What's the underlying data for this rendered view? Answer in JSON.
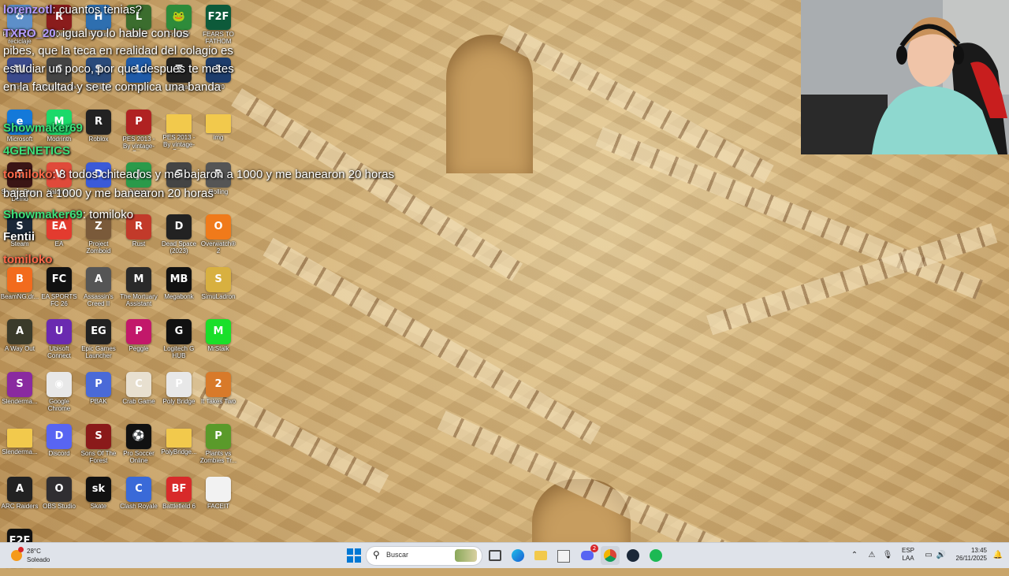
{
  "colors": {
    "taskbar_bg": "#dfe3ea",
    "chat_user_green": "#3ee07a",
    "chat_user_purple": "#b59cff",
    "chat_user_red": "#ff6a4a",
    "windows_blue": "#0078d4"
  },
  "chat": [
    {
      "user": "lorenzotl",
      "message": "cuantos tenias?",
      "user_color": "#b59cff"
    },
    {
      "user": "TXRO_20",
      "message": "igual yo lo hable con los pibes, que la teca en realidad del colagio es estudiar un poco, por que despues te metes en la facultad y se te complica una banda",
      "user_color": "#b59cff"
    },
    {
      "user": "Showmaker69",
      "message": "",
      "user_color": "#3ee07a"
    },
    {
      "user": "4GENETICS",
      "message": "",
      "user_color": "#3ee07a"
    },
    {
      "user": "tomiloko",
      "message": "8 todos chiteados y me bajaron a 1000 y me banearon 20 horas",
      "user_color": "#ff6a4a"
    },
    {
      "user": "Showmaker69",
      "message": "tomiloko",
      "user_color": "#3ee07a"
    },
    {
      "user": "Fentii",
      "message": "",
      "user_color": "#ffffff"
    },
    {
      "user": "tomiloko",
      "message": "",
      "user_color": "#ff6a4a"
    }
  ],
  "chat_lines": [
    "igual yo lo hable con los",
    "pibes, que la teca en realidad del colagio es",
    "estudiar un poco, por que despues te metes",
    "en la facultad y se te complica una banda"
  ],
  "chat_line2": "bajaron a 1000 y me banearon 20 horas",
  "desktop_icons": [
    {
      "label": "Papelera de reciclaje",
      "icon": "recycle-bin-icon",
      "color": "#5d8fc9",
      "glyph": "♻"
    },
    {
      "label": "Red Dead 2",
      "icon": "game-icon",
      "color": "#8a1c1c",
      "glyph": "R"
    },
    {
      "label": "Human",
      "icon": "game-icon",
      "color": "#2e6fb0",
      "glyph": "H"
    },
    {
      "label": "Ligas",
      "icon": "game-icon",
      "color": "#3b6d2e",
      "glyph": "L"
    },
    {
      "label": "Frogger",
      "icon": "frog-icon",
      "color": "#2e8b3a",
      "glyph": "🐸"
    },
    {
      "label": "FEARS TO FATHOM",
      "icon": "f2f-icon",
      "color": "#0d5a3a",
      "glyph": "F2F"
    },
    {
      "label": "Final",
      "icon": "game-icon",
      "color": "#3b4a8c",
      "glyph": "W"
    },
    {
      "label": "Rainbow Six",
      "icon": "game-icon",
      "color": "#444",
      "glyph": "6"
    },
    {
      "label": "Simulator",
      "icon": "game-icon",
      "color": "#2a4a7a",
      "glyph": "S"
    },
    {
      "label": "League",
      "icon": "game-icon",
      "color": "#1e5aa8",
      "glyph": "L"
    },
    {
      "label": "Tutorial",
      "icon": "game-icon",
      "color": "#222",
      "glyph": "T"
    },
    {
      "label": "1.30",
      "icon": "game-icon",
      "color": "#1d3c6b",
      "glyph": "1"
    },
    {
      "label": "Microsoft",
      "icon": "edge-icon",
      "color": "#1479d9",
      "glyph": "e"
    },
    {
      "label": "Modrinth",
      "icon": "modrinth-icon",
      "color": "#1bd96a",
      "glyph": "M"
    },
    {
      "label": "Roblox",
      "icon": "roblox-icon",
      "color": "#222",
      "glyph": "R"
    },
    {
      "label": "PES 2013 - By vintage-Ga...",
      "icon": "game-icon",
      "color": "#b02222",
      "glyph": "P"
    },
    {
      "label": "PES 2013 - By vintage-Ga...",
      "icon": "folder-icon",
      "color": "#f2c94c",
      "glyph": ""
    },
    {
      "label": "img",
      "icon": "folder-icon",
      "color": "#f2c94c",
      "glyph": ""
    },
    {
      "label": "Shutter Story Demo",
      "icon": "game-icon",
      "color": "#3a1515",
      "glyph": "S"
    },
    {
      "label": "Valorant",
      "icon": "game-icon",
      "color": "#e04a3a",
      "glyph": "V"
    },
    {
      "label": "",
      "icon": "game-icon",
      "color": "#3a5ad8",
      "glyph": "D"
    },
    {
      "label": "Juegos",
      "icon": "game-icon",
      "color": "#2a9a4a",
      "glyph": "J"
    },
    {
      "label": "",
      "icon": "game-icon",
      "color": "#444",
      "glyph": "G"
    },
    {
      "label": "Rolling",
      "icon": "game-icon",
      "color": "#555",
      "glyph": "R"
    },
    {
      "label": "Steam",
      "icon": "steam-icon",
      "color": "#1b2838",
      "glyph": "S"
    },
    {
      "label": "EA",
      "icon": "ea-icon",
      "color": "#e33b2f",
      "glyph": "EA"
    },
    {
      "label": "Project Zomboid",
      "icon": "game-icon",
      "color": "#7a5a3a",
      "glyph": "Z"
    },
    {
      "label": "Rust",
      "icon": "rust-icon",
      "color": "#c23a2a",
      "glyph": "R"
    },
    {
      "label": "Dead Space (2023)",
      "icon": "game-icon",
      "color": "#222",
      "glyph": "D"
    },
    {
      "label": "Overwatch® 2",
      "icon": "overwatch-icon",
      "color": "#f07a1a",
      "glyph": "O"
    },
    {
      "label": "BeamNG.dr...",
      "icon": "beamng-icon",
      "color": "#f26b1d",
      "glyph": "B"
    },
    {
      "label": "EA SPORTS FC 26",
      "icon": "game-icon",
      "color": "#111",
      "glyph": "FC"
    },
    {
      "label": "Assassin's Creed II",
      "icon": "game-icon",
      "color": "#555",
      "glyph": "A"
    },
    {
      "label": "The Mortuary Assistant",
      "icon": "game-icon",
      "color": "#2a2a2a",
      "glyph": "M"
    },
    {
      "label": "Megabonk",
      "icon": "game-icon",
      "color": "#111",
      "glyph": "MB"
    },
    {
      "label": "SimuLadron",
      "icon": "game-icon",
      "color": "#d8b040",
      "glyph": "S"
    },
    {
      "label": "A Way Out",
      "icon": "game-icon",
      "color": "#3a3a2a",
      "glyph": "A"
    },
    {
      "label": "Ubisoft Connect",
      "icon": "ubisoft-icon",
      "color": "#6a2ab0",
      "glyph": "U"
    },
    {
      "label": "Epic Games Launcher",
      "icon": "epic-icon",
      "color": "#222",
      "glyph": "EG"
    },
    {
      "label": "Peggle",
      "icon": "game-icon",
      "color": "#c2186a",
      "glyph": "P"
    },
    {
      "label": "Logitech G HUB",
      "icon": "logitech-icon",
      "color": "#111",
      "glyph": "G"
    },
    {
      "label": "MrStalk",
      "icon": "game-icon",
      "color": "#1adf2a",
      "glyph": "M"
    },
    {
      "label": "Slenderma...",
      "icon": "archive-icon",
      "color": "#8a2aa0",
      "glyph": "S"
    },
    {
      "label": "Google Chrome",
      "icon": "chrome-icon",
      "color": "#e8e8e8",
      "glyph": "◉"
    },
    {
      "label": "PBAK",
      "icon": "game-icon",
      "color": "#4a6ad8",
      "glyph": "P"
    },
    {
      "label": "Crab Game",
      "icon": "game-icon",
      "color": "#e8e0d0",
      "glyph": "C"
    },
    {
      "label": "Poly Bridge",
      "icon": "game-icon",
      "color": "#e8e8e8",
      "glyph": "P"
    },
    {
      "label": "It Takes Two",
      "icon": "game-icon",
      "color": "#d87a2a",
      "glyph": "2"
    },
    {
      "label": "Slenderma...",
      "icon": "folder-icon",
      "color": "#f2c94c",
      "glyph": ""
    },
    {
      "label": "Discord",
      "icon": "discord-icon",
      "color": "#5865f2",
      "glyph": "D"
    },
    {
      "label": "Sons Of The Forest",
      "icon": "game-icon",
      "color": "#8a1a1a",
      "glyph": "S"
    },
    {
      "label": "Pro Soccer Online",
      "icon": "game-icon",
      "color": "#111",
      "glyph": "⚽"
    },
    {
      "label": "PolyBridge...",
      "icon": "folder-icon",
      "color": "#f2c94c",
      "glyph": ""
    },
    {
      "label": "Plants vs Zombies Tr...",
      "icon": "game-icon",
      "color": "#5a9a2a",
      "glyph": "P"
    },
    {
      "label": "ARC Raiders",
      "icon": "game-icon",
      "color": "#222",
      "glyph": "A"
    },
    {
      "label": "OBS Studio",
      "icon": "obs-icon",
      "color": "#302e31",
      "glyph": "O"
    },
    {
      "label": "Skate",
      "icon": "game-icon",
      "color": "#111",
      "glyph": "sk"
    },
    {
      "label": "Clash Royale",
      "icon": "game-icon",
      "color": "#3a6ad8",
      "glyph": "C"
    },
    {
      "label": "Battlefield 6",
      "icon": "game-icon",
      "color": "#d82a2a",
      "glyph": "BF"
    },
    {
      "label": "FACEIT",
      "icon": "file-icon",
      "color": "#f2f2f2",
      "glyph": ""
    },
    {
      "label": "Fears to Fathom...",
      "icon": "f2f-icon",
      "color": "#111",
      "glyph": "F2F"
    }
  ],
  "taskbar": {
    "weather_temp": "28°C",
    "weather_desc": "Soleado",
    "search_placeholder": "Buscar",
    "language": "ESP",
    "layout": "LAA",
    "time": "13:45",
    "date": "26/11/2025",
    "discord_badge": "2"
  }
}
